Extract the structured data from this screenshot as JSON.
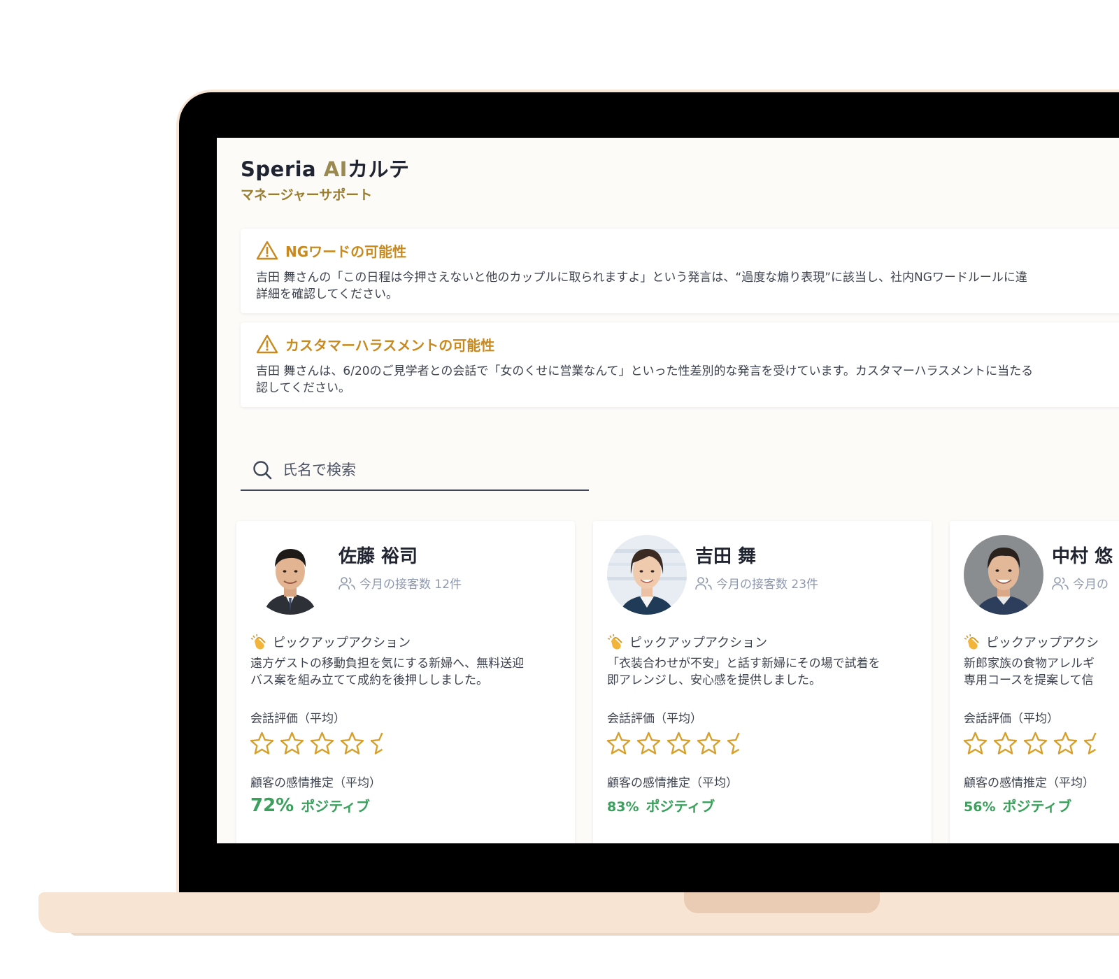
{
  "app": {
    "brand_name": "Speria",
    "brand_ai": "AI",
    "brand_karte": "カルテ",
    "subtitle": "マネージャーサポート"
  },
  "alerts": [
    {
      "icon": "warning-triangle-icon",
      "title": "NGワードの可能性",
      "body_line1": "吉田 舞さんの「この日程は今押さえないと他のカップルに取られますよ」という発言は、“過度な煽り表現”に該当し、社内NGワードルールに違",
      "body_line2": "詳細を確認してください。"
    },
    {
      "icon": "warning-triangle-icon",
      "title": "カスタマーハラスメントの可能性",
      "body_line1": "吉田 舞さんは、6/20のご見学者との会話で「女のくせに営業なんて」といった性差別的な発言を受けています。カスタマーハラスメントに当たる",
      "body_line2": "認してください。"
    }
  ],
  "search": {
    "placeholder": "氏名で検索",
    "icon": "search-icon"
  },
  "colors": {
    "accent_gold": "#c88a1f",
    "positive_green": "#3aa05c",
    "star_gold": "#d6a02a"
  },
  "employees": [
    {
      "name": "佐藤 裕司",
      "count_text": "今月の接客数 12件",
      "pick_label": "ピックアップアクション",
      "pick_text": "遠方ゲストの移動負担を気にする新婦へ、無料送迎\nバス案を組み立てて成約を後押ししました。",
      "conv_label": "会話評価（平均）",
      "rating": 4.5,
      "emotion_label": "顧客の感情推定（平均）",
      "sentiment_pct": "72%",
      "sentiment_label": "ポジティブ"
    },
    {
      "name": "吉田 舞",
      "count_text": "今月の接客数 23件",
      "pick_label": "ピックアップアクション",
      "pick_text": "「衣装合わせが不安」と話す新婦にその場で試着を\n即アレンジし、安心感を提供しました。",
      "conv_label": "会話評価（平均）",
      "rating": 4.5,
      "emotion_label": "顧客の感情推定（平均）",
      "sentiment_pct": "83%",
      "sentiment_label": "ポジティブ"
    },
    {
      "name": "中村 悠",
      "count_text": "今月の",
      "pick_label": "ピックアップアクシ",
      "pick_text": "新郎家族の食物アレルギ\n専用コースを提案して信",
      "conv_label": "会話評価（平均）",
      "rating": 4.5,
      "emotion_label": "顧客の感情推定（平均）",
      "sentiment_pct": "56%",
      "sentiment_label": "ポジティブ"
    }
  ]
}
